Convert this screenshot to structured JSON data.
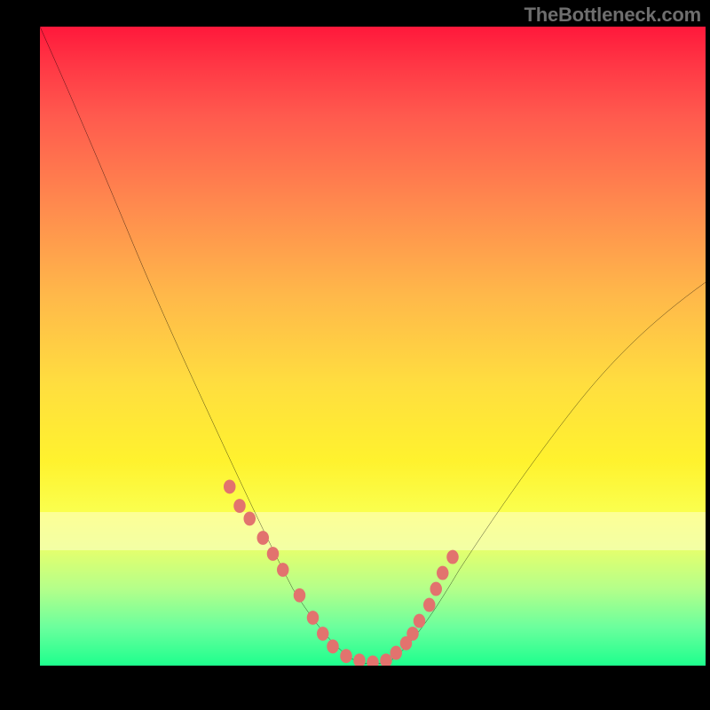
{
  "watermark": "TheBottleneck.com",
  "chart_data": {
    "type": "line",
    "title": "",
    "xlabel": "",
    "ylabel": "",
    "xlim": [
      0,
      100
    ],
    "ylim": [
      0,
      100
    ],
    "grid": false,
    "series": [
      {
        "name": "bottleneck-curve",
        "x": [
          0,
          4,
          8,
          12,
          16,
          20,
          24,
          28,
          32,
          36,
          40,
          42,
          44,
          46,
          48,
          50,
          52,
          56,
          60,
          66,
          72,
          80,
          88,
          96,
          100
        ],
        "y": [
          100,
          92,
          83,
          74,
          65,
          56,
          47,
          38,
          30,
          22,
          14,
          10,
          6,
          3,
          1,
          0,
          1,
          4,
          9,
          17,
          26,
          37,
          47,
          56,
          60
        ]
      }
    ],
    "markers": {
      "name": "highlight-points",
      "color": "#e2736e",
      "x": [
        28.5,
        30,
        31.5,
        33.5,
        35,
        36.5,
        39,
        41,
        42.5,
        44,
        46,
        48,
        50,
        52,
        53.5,
        55,
        56,
        57,
        58.5,
        59.5,
        60.5,
        62
      ],
      "y": [
        28,
        25,
        23,
        20,
        17.5,
        15,
        11,
        7.5,
        5,
        3,
        1.5,
        0.8,
        0.5,
        0.8,
        2,
        3.5,
        5,
        7,
        9.5,
        12,
        14.5,
        17
      ]
    },
    "overlay_band": {
      "y0": 18,
      "y1": 24,
      "opacity": 0.55
    },
    "legend": false
  },
  "colors": {
    "curve": "#000000",
    "marker": "#e2736e",
    "frame": "#000000"
  }
}
